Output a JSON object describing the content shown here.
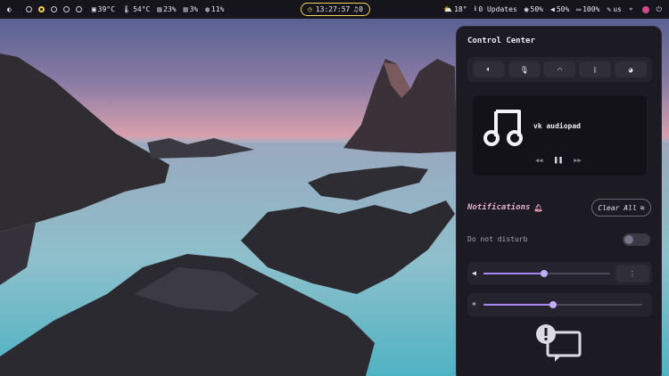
{
  "topbar": {
    "workspaces": [
      {
        "id": 1,
        "active": false
      },
      {
        "id": 2,
        "active": true
      },
      {
        "id": 3,
        "active": false
      },
      {
        "id": 4,
        "active": false
      },
      {
        "id": 5,
        "active": false
      }
    ],
    "cpu_temp": "39°C",
    "gpu_temp": "54°C",
    "memory": "23%",
    "cpu": "3%",
    "disk": "11%",
    "clock": "13:27:57",
    "notification_count": "0",
    "weather": "18°",
    "updates": "0 Updates",
    "brightness": "50%",
    "volume": "50%",
    "battery": "100%",
    "keyboard_layout": "us",
    "colors": {
      "accent": "#f2d15a",
      "bar_bg": "#16151c"
    }
  },
  "control_center": {
    "title": "Control Center",
    "quick_toggles": [
      {
        "name": "audio-output",
        "icon": "speaker-icon"
      },
      {
        "name": "microphone",
        "icon": "microphone-icon"
      },
      {
        "name": "wifi",
        "icon": "wifi-icon"
      },
      {
        "name": "bluetooth",
        "icon": "bluetooth-icon"
      },
      {
        "name": "theme",
        "icon": "palette-icon"
      }
    ],
    "media": {
      "track": "vk audiopad",
      "icon": "music-note-icon"
    },
    "notifications": {
      "title": "Notifications",
      "clear_all": "Clear All",
      "dnd_label": "Do not disturb",
      "dnd_enabled": false,
      "empty_icon": "no-notifications-icon"
    },
    "volume_level": 0.48,
    "brightness_level": 0.44,
    "colors": {
      "slider": "#a889f2",
      "notification_title": "#e6b0c7"
    }
  }
}
